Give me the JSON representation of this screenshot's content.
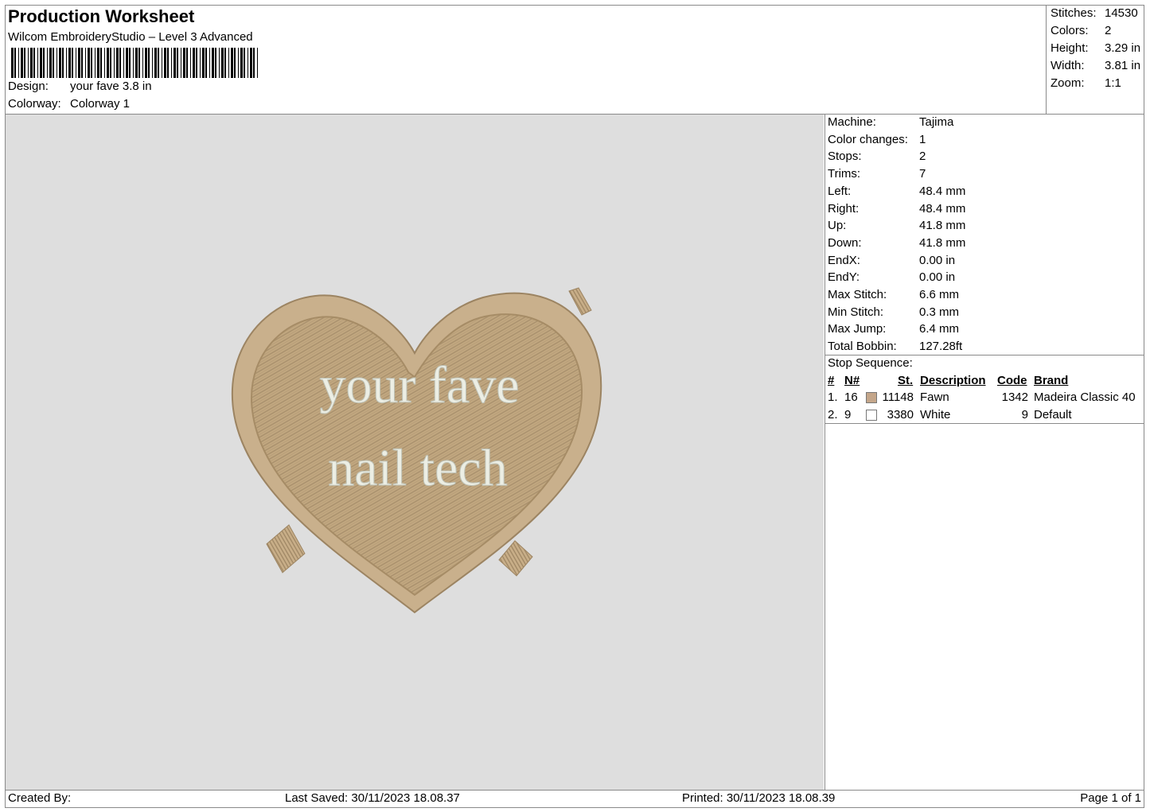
{
  "header": {
    "title": "Production Worksheet",
    "software": "Wilcom EmbroideryStudio – Level 3 Advanced",
    "design_label": "Design:",
    "design_value": "your fave 3.8 in",
    "colorway_label": "Colorway:",
    "colorway_value": "Colorway 1"
  },
  "summary": [
    {
      "label": "Stitches:",
      "value": "14530"
    },
    {
      "label": "Colors:",
      "value": "2"
    },
    {
      "label": "Height:",
      "value": "3.29 in"
    },
    {
      "label": "Width:",
      "value": "3.81 in"
    },
    {
      "label": "Zoom:",
      "value": "1:1"
    }
  ],
  "design_preview": {
    "text_line_1": "your fave",
    "text_line_2": "nail tech",
    "colors": {
      "fawn": "#c8b08c",
      "fawn_dark": "#a88f6c",
      "white_thread": "#eceee4",
      "background": "#dedede"
    }
  },
  "machine_info": [
    {
      "label": "Machine:",
      "value": "Tajima"
    },
    {
      "label": "Color changes:",
      "value": "1"
    },
    {
      "label": "Stops:",
      "value": "2"
    },
    {
      "label": "Trims:",
      "value": "7"
    },
    {
      "label": "Left:",
      "value": "48.4 mm"
    },
    {
      "label": "Right:",
      "value": "48.4 mm"
    },
    {
      "label": "Up:",
      "value": "41.8 mm"
    },
    {
      "label": "Down:",
      "value": "41.8 mm"
    },
    {
      "label": "EndX:",
      "value": "0.00 in"
    },
    {
      "label": "EndY:",
      "value": "0.00 in"
    },
    {
      "label": "Max Stitch:",
      "value": "6.6 mm"
    },
    {
      "label": "Min Stitch:",
      "value": "0.3 mm"
    },
    {
      "label": "Max Jump:",
      "value": "6.4 mm"
    },
    {
      "label": "Total Bobbin:",
      "value": "127.28ft"
    }
  ],
  "stop_sequence": {
    "title": "Stop Sequence:",
    "headers": {
      "num": "#",
      "n": "N#",
      "st": "St.",
      "description": "Description",
      "code": "Code",
      "brand": "Brand"
    },
    "rows": [
      {
        "num": "1.",
        "n": "16",
        "swatch": "#c4a68a",
        "st": "11148",
        "description": "Fawn",
        "code": "1342",
        "brand": "Madeira Classic 40"
      },
      {
        "num": "2.",
        "n": "9",
        "swatch": "#ffffff",
        "st": "3380",
        "description": "White",
        "code": "9",
        "brand": "Default"
      }
    ]
  },
  "footer": {
    "created_by": "Created By:",
    "last_saved": "Last Saved: 30/11/2023 18.08.37",
    "printed": "Printed: 30/11/2023 18.08.39",
    "page": "Page 1 of 1"
  }
}
